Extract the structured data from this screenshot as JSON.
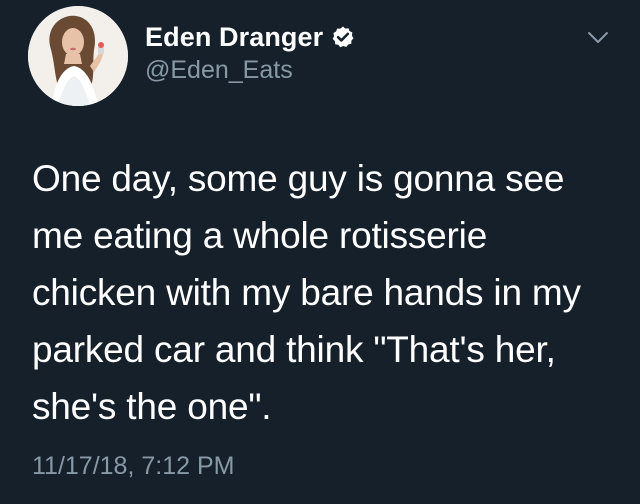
{
  "author": {
    "display_name": "Eden Dranger",
    "handle": "@Eden_Eats",
    "verified_icon": "verified-badge-icon",
    "avatar": "avatar-photo"
  },
  "menu": {
    "icon": "chevron-down-icon"
  },
  "tweet": {
    "lines": [
      "One day, some guy is gonna see",
      "me eating a whole rotisserie",
      "chicken with my bare hands in my",
      "parked car and think \"That's her,",
      "she's the one\"."
    ],
    "timestamp": "11/17/18, 7:12 PM"
  },
  "colors": {
    "background": "#15202b",
    "text": "#ffffff",
    "secondary": "#8899a6"
  }
}
